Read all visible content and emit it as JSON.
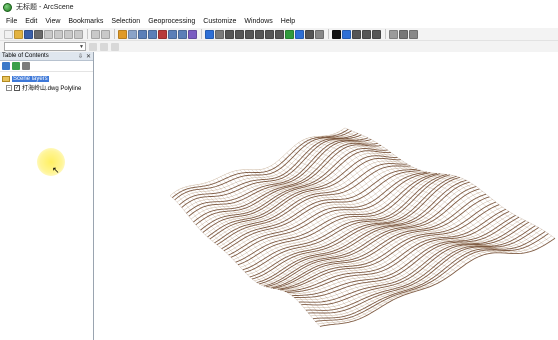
{
  "window": {
    "title": "无标题 - ArcScene",
    "app_icon": "arcscene-globe-icon"
  },
  "menu": [
    "File",
    "Edit",
    "View",
    "Bookmarks",
    "Selection",
    "Geoprocessing",
    "Customize",
    "Windows",
    "Help"
  ],
  "toolbar": {
    "buttons": [
      {
        "icon": "new-icon",
        "color": "#f1f1f1"
      },
      {
        "icon": "open-folder-icon",
        "color": "#e3b341"
      },
      {
        "icon": "save-icon",
        "color": "#3a5fa8"
      },
      {
        "icon": "print-icon",
        "color": "#6b6b6b"
      },
      {
        "icon": "cut-icon",
        "color": "#c9c9c9"
      },
      {
        "icon": "copy-icon",
        "color": "#c9c9c9"
      },
      {
        "icon": "paste-icon",
        "color": "#c9c9c9"
      },
      {
        "icon": "delete-icon",
        "color": "#c9c9c9"
      },
      {
        "sep": true
      },
      {
        "icon": "undo-icon",
        "color": "#c9c9c9"
      },
      {
        "icon": "redo-icon",
        "color": "#c9c9c9"
      },
      {
        "sep": true
      },
      {
        "icon": "add-data-icon",
        "color": "#e09a27"
      },
      {
        "icon": "scene-properties-icon",
        "color": "#8aa3c8"
      },
      {
        "icon": "layout-icon",
        "color": "#5b7fb8"
      },
      {
        "icon": "catalog-icon",
        "color": "#5b7fb8"
      },
      {
        "icon": "toolbox-icon",
        "color": "#b83a3a"
      },
      {
        "icon": "python-icon",
        "color": "#5b7fb8"
      },
      {
        "icon": "model-builder-icon",
        "color": "#5b7fb8"
      },
      {
        "icon": "editor-icon",
        "color": "#7a5cc2"
      },
      {
        "sep": true
      },
      {
        "icon": "navigate-icon",
        "color": "#2e6fd6"
      },
      {
        "icon": "fly-icon",
        "color": "#7a7a7a"
      },
      {
        "icon": "center-target-icon",
        "color": "#555555"
      },
      {
        "icon": "zoom-target-icon",
        "color": "#555555"
      },
      {
        "icon": "set-observer-icon",
        "color": "#555555"
      },
      {
        "icon": "zoom-in-icon",
        "color": "#555555"
      },
      {
        "icon": "zoom-out-icon",
        "color": "#555555"
      },
      {
        "icon": "pan-icon",
        "color": "#555555"
      },
      {
        "icon": "full-extent-icon",
        "color": "#2f9a3b"
      },
      {
        "icon": "zoom-to-layer-icon",
        "color": "#2e6fd6"
      },
      {
        "icon": "narrow-fov-icon",
        "color": "#555555"
      },
      {
        "icon": "expand-dropdown-icon",
        "color": "#888888"
      },
      {
        "sep": true
      },
      {
        "icon": "select-arrow-icon",
        "color": "#111111"
      },
      {
        "icon": "identify-icon",
        "color": "#2e6fd6"
      },
      {
        "icon": "find-icon",
        "color": "#555555"
      },
      {
        "icon": "measure-icon",
        "color": "#555555"
      },
      {
        "icon": "hyperlink-icon",
        "color": "#555555"
      },
      {
        "sep": true
      },
      {
        "icon": "animation-icon",
        "color": "#9b9b9b"
      },
      {
        "icon": "scene-settings-icon",
        "color": "#777777"
      },
      {
        "icon": "more-dropdown-icon",
        "color": "#888888"
      }
    ]
  },
  "toolbar2": {
    "layer_select_value": ""
  },
  "toc": {
    "title": "Table of Contents",
    "pin_glyph": "⇩",
    "close_glyph": "✕",
    "tools": [
      {
        "icon": "list-by-drawing-order-icon",
        "color": "#3a78c9"
      },
      {
        "icon": "list-by-source-icon",
        "color": "#3aa04a"
      },
      {
        "icon": "list-by-visibility-icon",
        "color": "#7c7c7c"
      }
    ],
    "scene_layers_label": "Scene layers",
    "expander_glyph": "−",
    "check_glyph": "✓",
    "layers": [
      {
        "name": "打海岭山.dwg Polyline",
        "checked": true
      }
    ]
  },
  "cursor_glyph": "↖",
  "colors": {
    "contour": "#6b4226",
    "contour_light": "#a8845c",
    "selection": "#3d78d8"
  }
}
